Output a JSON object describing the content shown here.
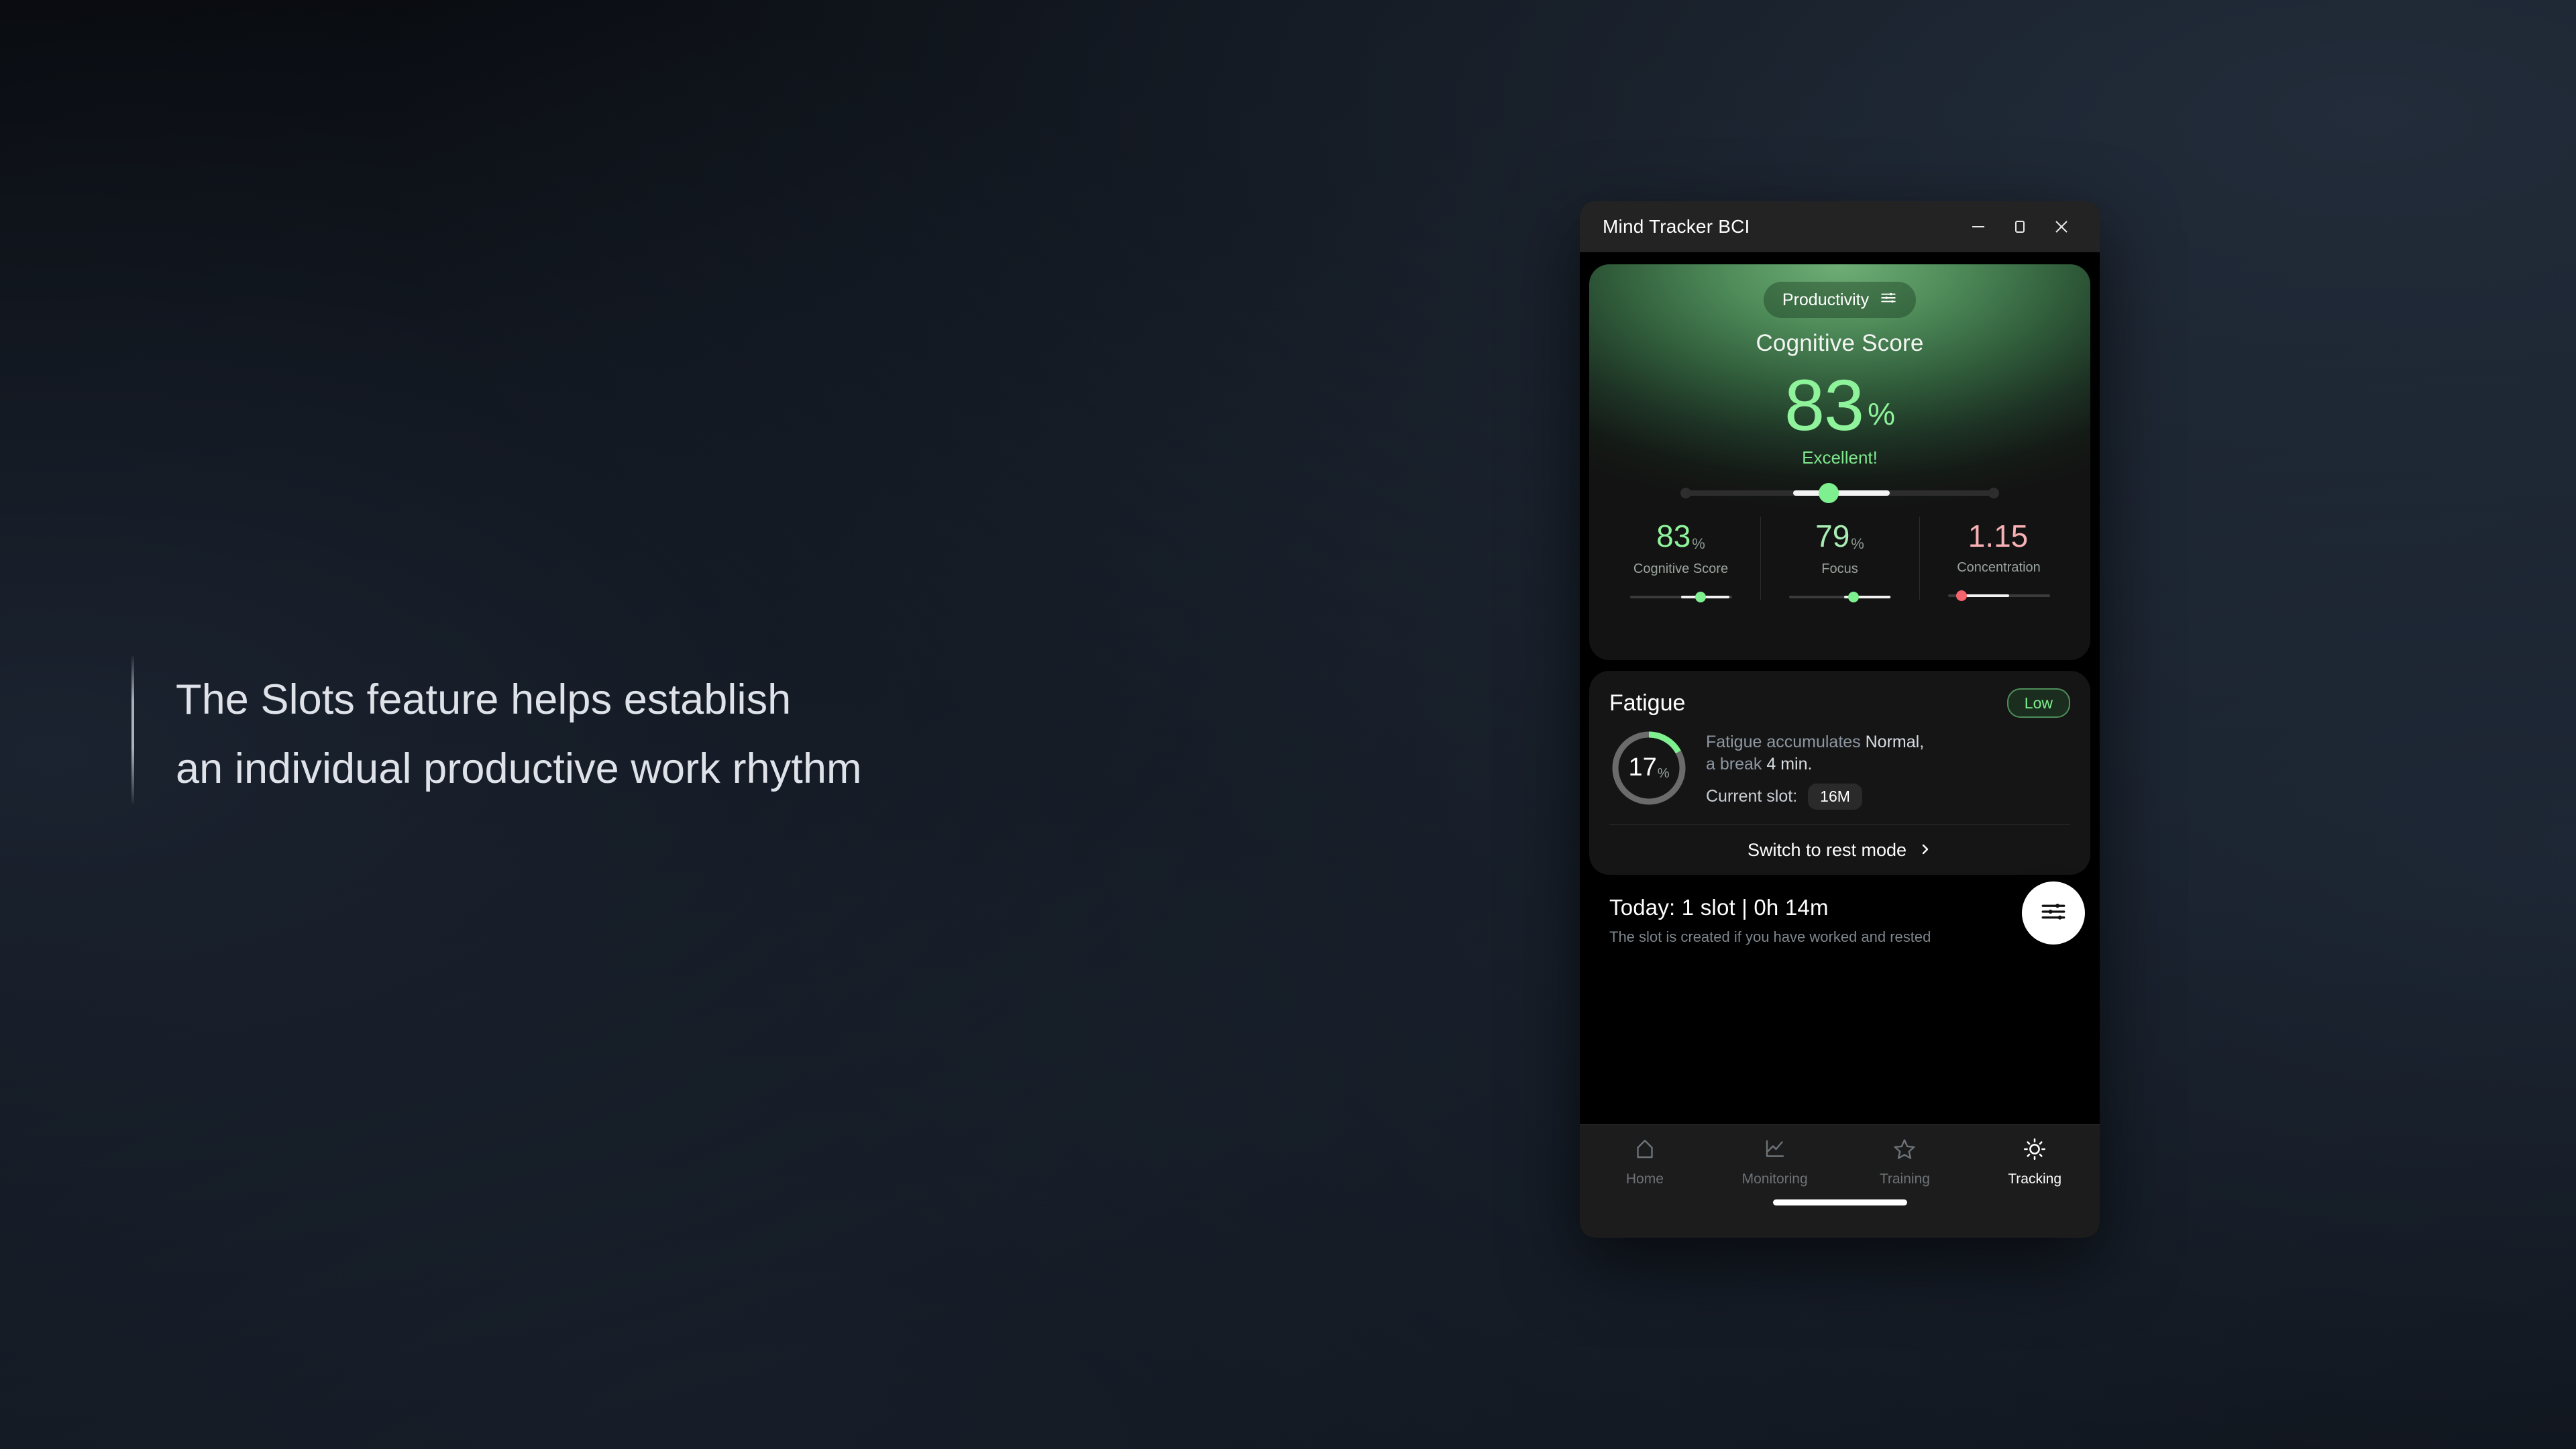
{
  "headline": {
    "text": "The Slots feature helps establish\nan individual productive work rhythm"
  },
  "window": {
    "title": "Mind Tracker BCI",
    "controls": {
      "minimize": "minimize-button",
      "maximize": "maximize-button",
      "close": "close-button"
    }
  },
  "cognitive_card": {
    "pill_label": "Productivity",
    "pill_icon": "tune-sliders-icon",
    "title": "Cognitive Score",
    "score_value": "83",
    "score_unit": "%",
    "score_label": "Excellent!",
    "slider": {
      "position_percent": 44,
      "fill_start_percent": 35,
      "fill_end_percent": 66,
      "thumb_color": "#7ff08f",
      "fill_color": "#f4f4f4",
      "track_color": "#2d2d2d"
    },
    "metrics": [
      {
        "value": "83",
        "unit": "%",
        "label": "Cognitive Score",
        "color": "#8ef39a",
        "thumb_color": "#7ff08f",
        "fill_left_percent": 50,
        "fill_width_percent": 48,
        "thumb_percent": 72
      },
      {
        "value": "79",
        "unit": "%",
        "label": "Focus",
        "color": "#a9edb4",
        "thumb_color": "#7ff08f",
        "fill_left_percent": 54,
        "fill_width_percent": 46,
        "thumb_percent": 66
      },
      {
        "value": "1.15",
        "unit": "",
        "label": "Concentration",
        "color": "#f7b0b4",
        "thumb_color": "#f4646e",
        "fill_left_percent": 14,
        "fill_width_percent": 46,
        "thumb_percent": 16
      }
    ]
  },
  "fatigue_card": {
    "title": "Fatigue",
    "badge": "Low",
    "donut": {
      "value": "17",
      "unit": "%",
      "percent": 17,
      "arc_color": "#7ff08f",
      "track_color": "#6b6b6b"
    },
    "description_prefix": "Fatigue accumulates ",
    "description_level": "Normal,",
    "description_mid": "a break ",
    "description_break": "4 min.",
    "slot_label": "Current slot:",
    "slot_chip": "16M",
    "rest_mode_label": "Switch to rest mode",
    "rest_mode_icon": "chevron-right-icon"
  },
  "today": {
    "title": "Today: 1 slot | 0h 14m",
    "subtitle": "The slot is created if you have worked and rested",
    "fab_icon": "tune-sliders-icon"
  },
  "bottom_nav": {
    "items": [
      {
        "label": "Home",
        "icon": "home-icon",
        "active": false
      },
      {
        "label": "Monitoring",
        "icon": "line-chart-icon",
        "active": false
      },
      {
        "label": "Training",
        "icon": "star-icon",
        "active": false
      },
      {
        "label": "Tracking",
        "icon": "sun-brightness-icon",
        "active": true
      }
    ]
  },
  "colors": {
    "accent_green": "#7ff08f",
    "accent_red": "#f4646e",
    "card_dark": "#151515",
    "window_chrome": "#232323"
  }
}
